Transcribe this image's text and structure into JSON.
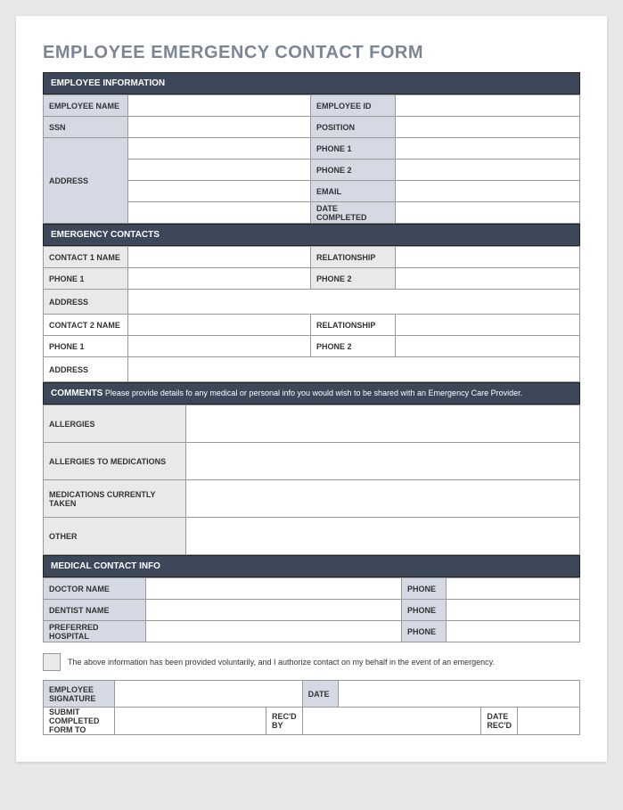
{
  "title": "EMPLOYEE EMERGENCY CONTACT FORM",
  "sections": {
    "employee_info": {
      "header": "EMPLOYEE INFORMATION",
      "labels": {
        "name": "EMPLOYEE NAME",
        "id": "EMPLOYEE ID",
        "ssn": "SSN",
        "position": "POSITION",
        "address": "ADDRESS",
        "phone1": "PHONE 1",
        "phone2": "PHONE 2",
        "email": "EMAIL",
        "date_completed": "DATE COMPLETED"
      }
    },
    "emergency": {
      "header": "EMERGENCY CONTACTS",
      "labels": {
        "contact1": "CONTACT 1 NAME",
        "contact2": "CONTACT 2 NAME",
        "relationship": "RELATIONSHIP",
        "phone1": "PHONE 1",
        "phone2": "PHONE 2",
        "address": "ADDRESS"
      }
    },
    "comments": {
      "header_bold": "COMMENTS",
      "header_text": " Please provide details fo any medical or personal info you would wish to be shared with an Emergency Care Provider.",
      "labels": {
        "allergies": "ALLERGIES",
        "allergies_meds": "ALLERGIES TO MEDICATIONS",
        "meds_taken": "MEDICATIONS CURRENTLY TAKEN",
        "other": "OTHER"
      }
    },
    "medical": {
      "header": "MEDICAL CONTACT INFO",
      "labels": {
        "doctor": "DOCTOR NAME",
        "dentist": "DENTIST NAME",
        "hospital": "PREFERRED HOSPITAL",
        "phone": "PHONE"
      }
    },
    "auth": {
      "text": "The above information has been provided voluntarily, and I authorize contact on my behalf in the event of an emergency."
    },
    "signature": {
      "labels": {
        "signature": "EMPLOYEE SIGNATURE",
        "date": "DATE",
        "submit_to": "SUBMIT COMPLETED FORM TO",
        "recd_by": "REC'D BY",
        "date_recd": "DATE REC'D"
      }
    }
  }
}
